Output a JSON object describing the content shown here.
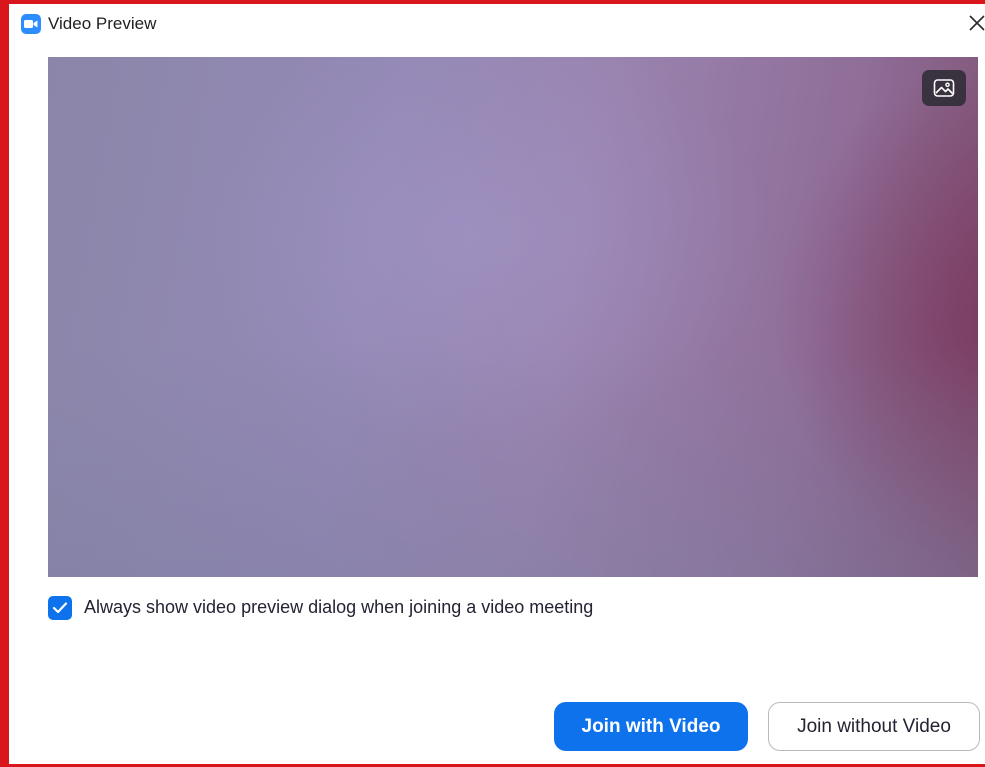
{
  "window": {
    "title": "Video Preview",
    "app_icon": "zoom-camera-icon",
    "close_icon": "close-icon"
  },
  "preview": {
    "background_button_icon": "image-icon"
  },
  "options": {
    "always_show_preview": {
      "label": "Always show video preview dialog when joining a video meeting",
      "checked": true
    }
  },
  "actions": {
    "join_with_video": "Join with Video",
    "join_without_video": "Join without Video"
  },
  "colors": {
    "window_border": "#d9161c",
    "accent": "#0e72ed",
    "app_icon": "#2d8cff"
  }
}
